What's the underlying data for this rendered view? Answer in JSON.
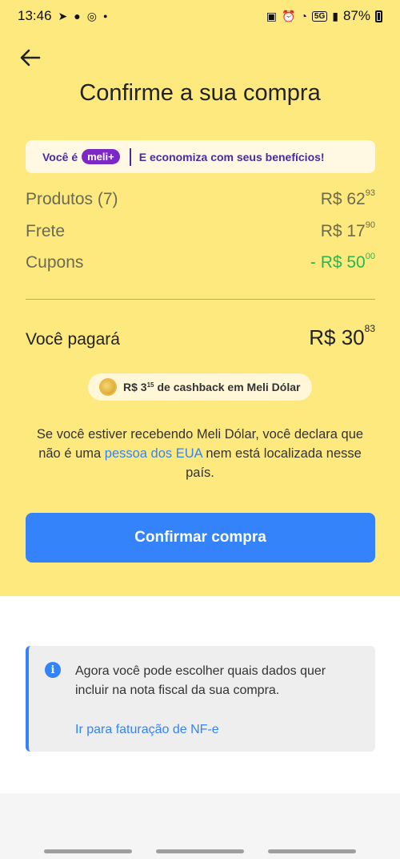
{
  "status": {
    "time": "13:46",
    "left_icons": [
      "telegram-icon",
      "chat-icon",
      "whatsapp-icon",
      "dot-icon"
    ],
    "network": "5G",
    "battery": "87%"
  },
  "header": {
    "title": "Confirme a sua compra"
  },
  "banner": {
    "prefix": "Você é",
    "badge": "meli+",
    "text": "E economiza com seus benefícios!"
  },
  "summary": {
    "items": [
      {
        "label": "Produtos (7)",
        "currency": "R$ 62",
        "cents": "93",
        "color": "default"
      },
      {
        "label": "Frete",
        "currency": "R$ 17",
        "cents": "90",
        "color": "default"
      },
      {
        "label": "Cupons",
        "currency": "- R$ 50",
        "cents": "00",
        "color": "#2fb34f"
      }
    ],
    "total_label": "Você pagará",
    "total_currency": "R$ 30",
    "total_cents": "83"
  },
  "cashback": {
    "amount": "R$ 3",
    "cents": "15",
    "text": "de cashback em Meli Dólar"
  },
  "declaration": {
    "part1": "Se você estiver recebendo Meli Dólar, você declara que não é uma ",
    "link": "pessoa dos EUA",
    "part2": " nem está localizada nesse país."
  },
  "actions": {
    "confirm_label": "Confirmar compra"
  },
  "notice": {
    "text": "Agora você pode escolher quais dados quer incluir na nota fiscal da sua compra.",
    "link": "Ir para faturação de NF-e"
  },
  "colors": {
    "background": "#fee97f",
    "accent": "#3483fa",
    "meli_plus": "#7b28c4"
  }
}
